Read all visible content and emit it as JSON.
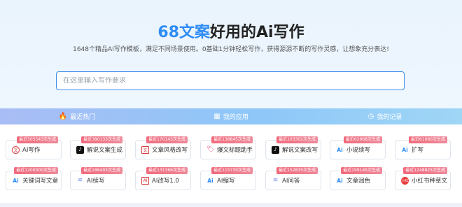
{
  "hero": {
    "title_accent": "68文案",
    "title_rest": "好用的Ai写作",
    "subtitle": "1648个精品AI写作模板，满足不同场景使用。0基础1分钟轻松写作，获得源源不断的写作灵感，让想象充分表达!"
  },
  "search": {
    "placeholder": "在这里输入写作要求"
  },
  "tabs": [
    {
      "label": "最近热门",
      "icon": "flame-icon",
      "glyph": "🔥"
    },
    {
      "label": "我的应用",
      "icon": "grid-icon",
      "glyph": "▦"
    },
    {
      "label": "我的记录",
      "icon": "clock-icon",
      "glyph": "◷"
    }
  ],
  "cards_row1": [
    {
      "badge": "最近505543次生成",
      "label": "AI写作",
      "icon": "ring-icon",
      "glyph": "文"
    },
    {
      "badge": "最近380133次生成",
      "label": "解说文案生成",
      "icon": "tiktok-icon",
      "glyph": "♪"
    },
    {
      "badge": "最近170143次生成",
      "label": "文章风格改写",
      "icon": "doc-icon",
      "glyph": "文"
    },
    {
      "badge": "最近138845次生成",
      "label": "爆文标题助手",
      "icon": "tag-icon",
      "glyph": "🏷"
    },
    {
      "badge": "最近103302次生成",
      "label": "解说文案改写",
      "icon": "tiktok-icon",
      "glyph": "♪"
    },
    {
      "badge": "最近62968次生成",
      "label": "小说续写",
      "icon": "ai-icon",
      "glyph": "Ai"
    },
    {
      "badge": "最近61060次生成",
      "label": "扩写",
      "icon": "ai-icon",
      "glyph": "Ai"
    }
  ],
  "cards_row2": [
    {
      "badge": "最近1200000次生成",
      "label": "关键词写文章",
      "icon": "ai-icon",
      "glyph": "Ai"
    },
    {
      "badge": "最近186493次生成",
      "label": "AI续写",
      "icon": "wave-icon",
      "glyph": "≋"
    },
    {
      "badge": "最近131366次生成",
      "label": "AI改写1.0",
      "icon": "doc-icon",
      "glyph": "AI"
    },
    {
      "badge": "最近115730次生成",
      "label": "AI缩写",
      "icon": "ai-icon",
      "glyph": "Ai"
    },
    {
      "badge": "最近152835次生成",
      "label": "AI问答",
      "icon": "wave-icon",
      "glyph": "≋"
    },
    {
      "badge": "最近199145次生成",
      "label": "文章润色",
      "icon": "ai-icon",
      "glyph": "Ai"
    },
    {
      "badge": "最近1248825次生成",
      "label": "小红书种草文",
      "icon": "redbook-icon",
      "glyph": "小红"
    }
  ]
}
